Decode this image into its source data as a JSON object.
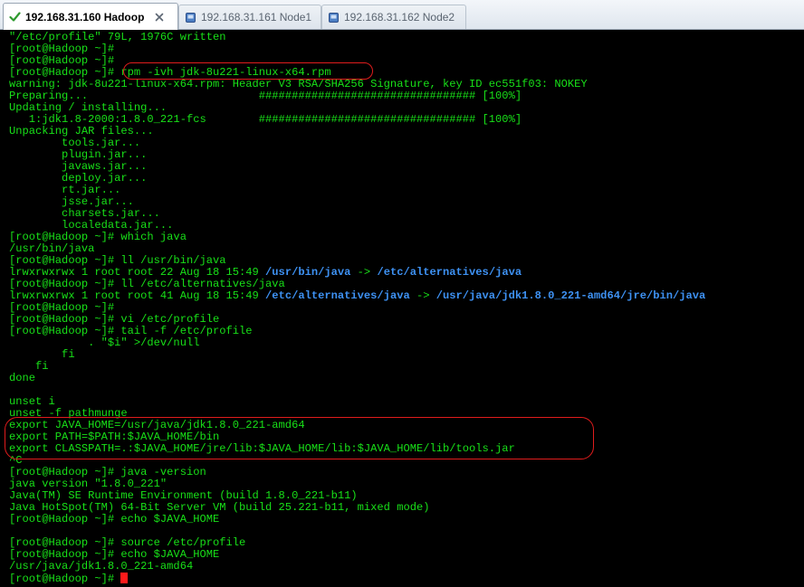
{
  "tabs": [
    {
      "label": "192.168.31.160 Hadoop",
      "active": true
    },
    {
      "label": "192.168.31.161 Node1",
      "active": false
    },
    {
      "label": "192.168.31.162 Node2",
      "active": false
    }
  ],
  "terminal": {
    "lines": [
      "\"/etc/profile\" 79L, 1976C written",
      "[root@Hadoop ~]#",
      "[root@Hadoop ~]#",
      "[root@Hadoop ~]# rpm -ivh jdk-8u221-linux-x64.rpm",
      "warning: jdk-8u221-linux-x64.rpm: Header V3 RSA/SHA256 Signature, key ID ec551f03: NOKEY",
      "Preparing...                          ################################# [100%]",
      "Updating / installing...",
      "   1:jdk1.8-2000:1.8.0_221-fcs        ################################# [100%]",
      "Unpacking JAR files...",
      "        tools.jar...",
      "        plugin.jar...",
      "        javaws.jar...",
      "        deploy.jar...",
      "        rt.jar...",
      "        jsse.jar...",
      "        charsets.jar...",
      "        localedata.jar...",
      "[root@Hadoop ~]# which java",
      "/usr/bin/java",
      "[root@Hadoop ~]# ll /usr/bin/java",
      "lrwxrwxrwx 1 root root 22 Aug 18 15:49 ",
      "[root@Hadoop ~]# ll /etc/alternatives/java",
      "lrwxrwxrwx 1 root root 41 Aug 18 15:49 ",
      "[root@Hadoop ~]#",
      "[root@Hadoop ~]# vi /etc/profile",
      "[root@Hadoop ~]# tail -f /etc/profile",
      "            . \"$i\" >/dev/null",
      "        fi",
      "    fi",
      "done",
      "",
      "unset i",
      "unset -f pathmunge",
      "export JAVA_HOME=/usr/java/jdk1.8.0_221-amd64",
      "export PATH=$PATH:$JAVA_HOME/bin",
      "export CLASSPATH=.:$JAVA_HOME/jre/lib:$JAVA_HOME/lib:$JAVA_HOME/lib/tools.jar",
      "^C",
      "[root@Hadoop ~]# java -version",
      "java version \"1.8.0_221\"",
      "Java(TM) SE Runtime Environment (build 1.8.0_221-b11)",
      "Java HotSpot(TM) 64-Bit Server VM (build 25.221-b11, mixed mode)",
      "[root@Hadoop ~]# echo $JAVA_HOME",
      "",
      "[root@Hadoop ~]# source /etc/profile",
      "[root@Hadoop ~]# echo $JAVA_HOME",
      "/usr/java/jdk1.8.0_221-amd64",
      "[root@Hadoop ~]# "
    ],
    "symlink1": {
      "path": "/usr/bin/java",
      "arrow": " -> ",
      "target": "/etc/alternatives/java"
    },
    "symlink2": {
      "path": "/etc/alternatives/java",
      "arrow": " -> ",
      "target": "/usr/java/jdk1.8.0_221-amd64/jre/bin/java"
    }
  },
  "colors": {
    "text": "#18e018",
    "symlink": "#3e92f4",
    "background": "#000000",
    "highlight": "#e01c1c",
    "cursor": "#ff1a1a"
  }
}
